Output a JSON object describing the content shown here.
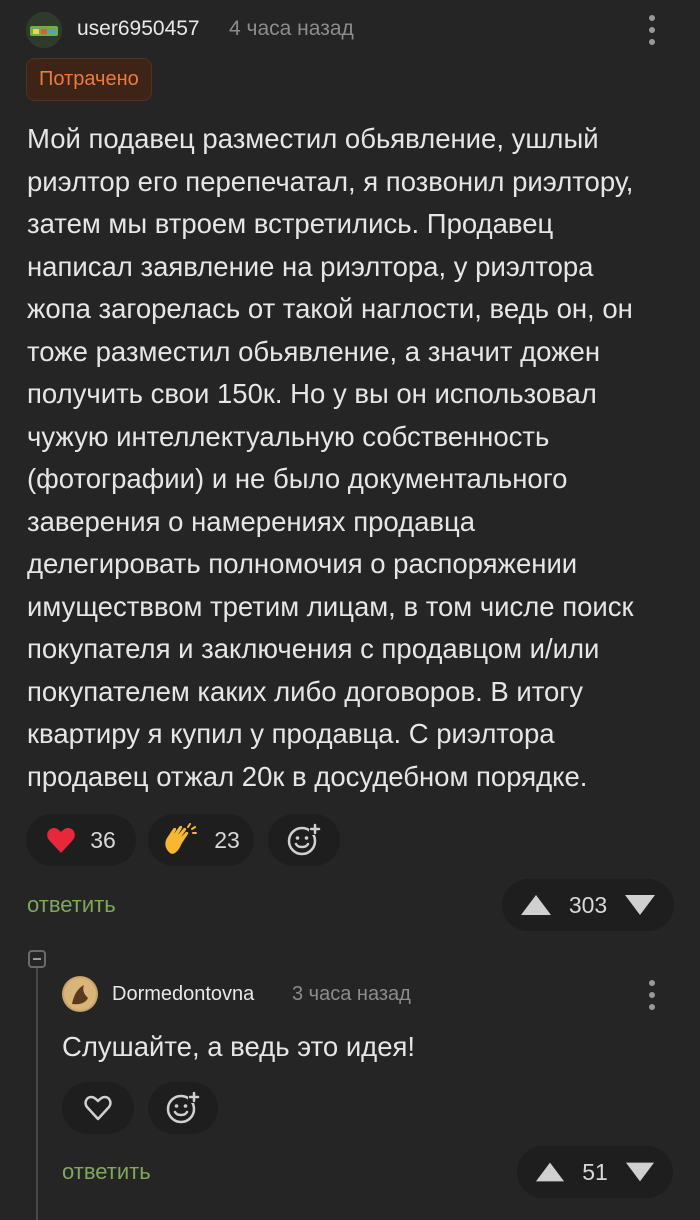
{
  "post": {
    "author": "user6950457",
    "time": "4 часа назад",
    "badge": "Потрачено",
    "text": "Мой подавец разместил обьявление, ушлый\nриэлтор его перепечатал, я позвонил риэлтору,\nзатем мы втроем встретились. Продавец\nнаписал заявление на риэлтора, у риэлтора\nжопа загорелась от такой наглости, ведь он, он\nтоже разместил обьявление, а значит дожен\nполучить свои 150к. Но у вы он использовал\nчужую интеллектуальную собственность\n(фотографии) и не было документального\nзаверения о намерениях продавца\nделегировать полномочия о распоряжении\nимуществвом третим лицам, в том числе поиск\nпокупателя и заключения с продавцом и/или\nпокупателем каких либо договоров. В итогу\nквартиру я купил у продавца. С риэлтора\nпродавец отжал 20к в досудебном порядке.",
    "reactions": [
      {
        "icon": "heart-icon",
        "count": "36"
      },
      {
        "icon": "clapping-hands-icon",
        "count": "23"
      }
    ],
    "reply_label": "ответить",
    "rating": "303"
  },
  "reply": {
    "author": "Dormedontovna",
    "time": "3 часа назад",
    "text": "Слушайте, а ведь это идея!",
    "reply_label": "ответить",
    "rating": "51"
  },
  "colors": {
    "background": "#252526",
    "accent_green": "#7fa85a",
    "badge_orange": "#f07a3a",
    "heart_red": "#e8283a"
  }
}
